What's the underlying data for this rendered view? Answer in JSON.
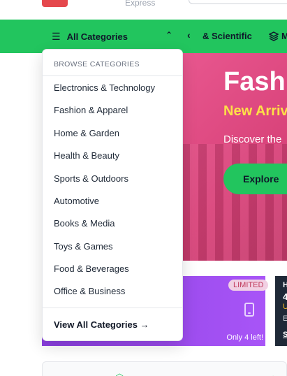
{
  "header": {
    "logo_subtitle": "Express"
  },
  "navbar": {
    "all_categories_label": "All Categories",
    "links": [
      "& Scientific",
      "M"
    ]
  },
  "dropdown": {
    "header": "BROWSE CATEGORIES",
    "items": [
      "Electronics & Technology",
      "Fashion & Apparel",
      "Home & Garden",
      "Health & Beauty",
      "Sports & Outdoors",
      "Automotive",
      "Books & Media",
      "Toys & Games",
      "Food & Beverages",
      "Office & Business"
    ],
    "view_all": "View All Categories →"
  },
  "hero": {
    "title": "Fash",
    "subtitle": "New Arriv",
    "description": "Discover the",
    "button": "Explore"
  },
  "deal_card_1": {
    "badge": "LIMITED",
    "stock": "Only 4 left!"
  },
  "deal_card_2": {
    "line1": "H",
    "line2": "4",
    "line3": "U",
    "line4": "E",
    "link": "S"
  },
  "colors": {
    "nav_green": "#22c55e",
    "hero_pink": "#e8578f",
    "hero_accent_yellow": "#fde047",
    "deal_purple": "#a855f7",
    "deal_dark": "#1f2937",
    "logo_red": "#e5484d"
  },
  "icons": [
    "hamburger-icon",
    "chevron-up-icon",
    "chevron-left-icon",
    "layers-icon",
    "tablet-icon"
  ]
}
